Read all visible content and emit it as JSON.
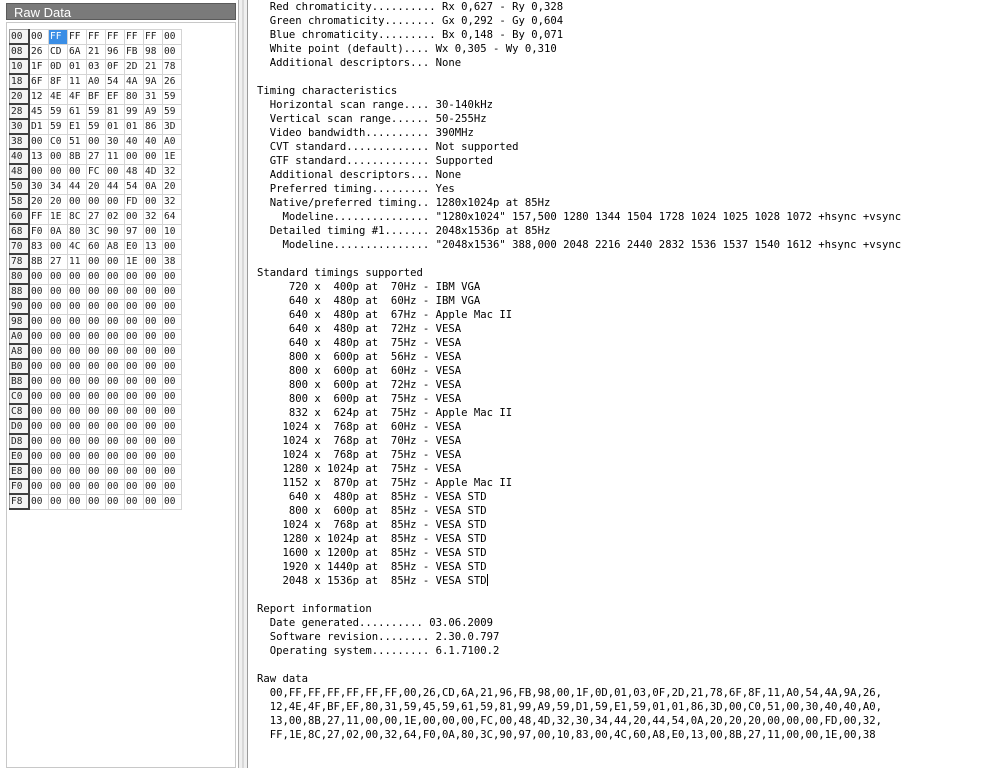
{
  "raw_panel": {
    "title": "Raw Data",
    "selected": {
      "row": 0,
      "col": 1
    },
    "rows": [
      {
        "addr": "00",
        "bytes": [
          "00",
          "FF",
          "FF",
          "FF",
          "FF",
          "FF",
          "FF",
          "00"
        ]
      },
      {
        "addr": "08",
        "bytes": [
          "26",
          "CD",
          "6A",
          "21",
          "96",
          "FB",
          "98",
          "00"
        ]
      },
      {
        "addr": "10",
        "bytes": [
          "1F",
          "0D",
          "01",
          "03",
          "0F",
          "2D",
          "21",
          "78"
        ]
      },
      {
        "addr": "18",
        "bytes": [
          "6F",
          "8F",
          "11",
          "A0",
          "54",
          "4A",
          "9A",
          "26"
        ]
      },
      {
        "addr": "20",
        "bytes": [
          "12",
          "4E",
          "4F",
          "BF",
          "EF",
          "80",
          "31",
          "59"
        ]
      },
      {
        "addr": "28",
        "bytes": [
          "45",
          "59",
          "61",
          "59",
          "81",
          "99",
          "A9",
          "59"
        ]
      },
      {
        "addr": "30",
        "bytes": [
          "D1",
          "59",
          "E1",
          "59",
          "01",
          "01",
          "86",
          "3D"
        ]
      },
      {
        "addr": "38",
        "bytes": [
          "00",
          "C0",
          "51",
          "00",
          "30",
          "40",
          "40",
          "A0"
        ]
      },
      {
        "addr": "40",
        "bytes": [
          "13",
          "00",
          "8B",
          "27",
          "11",
          "00",
          "00",
          "1E"
        ]
      },
      {
        "addr": "48",
        "bytes": [
          "00",
          "00",
          "00",
          "FC",
          "00",
          "48",
          "4D",
          "32"
        ]
      },
      {
        "addr": "50",
        "bytes": [
          "30",
          "34",
          "44",
          "20",
          "44",
          "54",
          "0A",
          "20"
        ]
      },
      {
        "addr": "58",
        "bytes": [
          "20",
          "20",
          "00",
          "00",
          "00",
          "FD",
          "00",
          "32"
        ]
      },
      {
        "addr": "60",
        "bytes": [
          "FF",
          "1E",
          "8C",
          "27",
          "02",
          "00",
          "32",
          "64"
        ]
      },
      {
        "addr": "68",
        "bytes": [
          "F0",
          "0A",
          "80",
          "3C",
          "90",
          "97",
          "00",
          "10"
        ]
      },
      {
        "addr": "70",
        "bytes": [
          "83",
          "00",
          "4C",
          "60",
          "A8",
          "E0",
          "13",
          "00"
        ]
      },
      {
        "addr": "78",
        "bytes": [
          "8B",
          "27",
          "11",
          "00",
          "00",
          "1E",
          "00",
          "38"
        ]
      },
      {
        "addr": "80",
        "bytes": [
          "00",
          "00",
          "00",
          "00",
          "00",
          "00",
          "00",
          "00"
        ]
      },
      {
        "addr": "88",
        "bytes": [
          "00",
          "00",
          "00",
          "00",
          "00",
          "00",
          "00",
          "00"
        ]
      },
      {
        "addr": "90",
        "bytes": [
          "00",
          "00",
          "00",
          "00",
          "00",
          "00",
          "00",
          "00"
        ]
      },
      {
        "addr": "98",
        "bytes": [
          "00",
          "00",
          "00",
          "00",
          "00",
          "00",
          "00",
          "00"
        ]
      },
      {
        "addr": "A0",
        "bytes": [
          "00",
          "00",
          "00",
          "00",
          "00",
          "00",
          "00",
          "00"
        ]
      },
      {
        "addr": "A8",
        "bytes": [
          "00",
          "00",
          "00",
          "00",
          "00",
          "00",
          "00",
          "00"
        ]
      },
      {
        "addr": "B0",
        "bytes": [
          "00",
          "00",
          "00",
          "00",
          "00",
          "00",
          "00",
          "00"
        ]
      },
      {
        "addr": "B8",
        "bytes": [
          "00",
          "00",
          "00",
          "00",
          "00",
          "00",
          "00",
          "00"
        ]
      },
      {
        "addr": "C0",
        "bytes": [
          "00",
          "00",
          "00",
          "00",
          "00",
          "00",
          "00",
          "00"
        ]
      },
      {
        "addr": "C8",
        "bytes": [
          "00",
          "00",
          "00",
          "00",
          "00",
          "00",
          "00",
          "00"
        ]
      },
      {
        "addr": "D0",
        "bytes": [
          "00",
          "00",
          "00",
          "00",
          "00",
          "00",
          "00",
          "00"
        ]
      },
      {
        "addr": "D8",
        "bytes": [
          "00",
          "00",
          "00",
          "00",
          "00",
          "00",
          "00",
          "00"
        ]
      },
      {
        "addr": "E0",
        "bytes": [
          "00",
          "00",
          "00",
          "00",
          "00",
          "00",
          "00",
          "00"
        ]
      },
      {
        "addr": "E8",
        "bytes": [
          "00",
          "00",
          "00",
          "00",
          "00",
          "00",
          "00",
          "00"
        ]
      },
      {
        "addr": "F0",
        "bytes": [
          "00",
          "00",
          "00",
          "00",
          "00",
          "00",
          "00",
          "00"
        ]
      },
      {
        "addr": "F8",
        "bytes": [
          "00",
          "00",
          "00",
          "00",
          "00",
          "00",
          "00",
          "00"
        ]
      }
    ]
  },
  "report": {
    "caret_line": 42,
    "lines": [
      "  Red chromaticity.......... Rx 0,627 - Ry 0,328",
      "  Green chromaticity........ Gx 0,292 - Gy 0,604",
      "  Blue chromaticity......... Bx 0,148 - By 0,071",
      "  White point (default).... Wx 0,305 - Wy 0,310",
      "  Additional descriptors... None",
      "",
      "Timing characteristics",
      "  Horizontal scan range.... 30-140kHz",
      "  Vertical scan range...... 50-255Hz",
      "  Video bandwidth.......... 390MHz",
      "  CVT standard............. Not supported",
      "  GTF standard............. Supported",
      "  Additional descriptors... None",
      "  Preferred timing......... Yes",
      "  Native/preferred timing.. 1280x1024p at 85Hz",
      "    Modeline............... \"1280x1024\" 157,500 1280 1344 1504 1728 1024 1025 1028 1072 +hsync +vsync",
      "  Detailed timing #1....... 2048x1536p at 85Hz",
      "    Modeline............... \"2048x1536\" 388,000 2048 2216 2440 2832 1536 1537 1540 1612 +hsync +vsync",
      "",
      "Standard timings supported",
      "     720 x  400p at  70Hz - IBM VGA",
      "     640 x  480p at  60Hz - IBM VGA",
      "     640 x  480p at  67Hz - Apple Mac II",
      "     640 x  480p at  72Hz - VESA",
      "     640 x  480p at  75Hz - VESA",
      "     800 x  600p at  56Hz - VESA",
      "     800 x  600p at  60Hz - VESA",
      "     800 x  600p at  72Hz - VESA",
      "     800 x  600p at  75Hz - VESA",
      "     832 x  624p at  75Hz - Apple Mac II",
      "    1024 x  768p at  60Hz - VESA",
      "    1024 x  768p at  70Hz - VESA",
      "    1024 x  768p at  75Hz - VESA",
      "    1280 x 1024p at  75Hz - VESA",
      "    1152 x  870p at  75Hz - Apple Mac II",
      "     640 x  480p at  85Hz - VESA STD",
      "     800 x  600p at  85Hz - VESA STD",
      "    1024 x  768p at  85Hz - VESA STD",
      "    1280 x 1024p at  85Hz - VESA STD",
      "    1600 x 1200p at  85Hz - VESA STD",
      "    1920 x 1440p at  85Hz - VESA STD",
      "    2048 x 1536p at  85Hz - VESA STD",
      "",
      "Report information",
      "  Date generated.......... 03.06.2009",
      "  Software revision........ 2.30.0.797",
      "  Operating system......... 6.1.7100.2",
      "",
      "Raw data",
      "  00,FF,FF,FF,FF,FF,FF,00,26,CD,6A,21,96,FB,98,00,1F,0D,01,03,0F,2D,21,78,6F,8F,11,A0,54,4A,9A,26,",
      "  12,4E,4F,BF,EF,80,31,59,45,59,61,59,81,99,A9,59,D1,59,E1,59,01,01,86,3D,00,C0,51,00,30,40,40,A0,",
      "  13,00,8B,27,11,00,00,1E,00,00,00,FC,00,48,4D,32,30,34,44,20,44,54,0A,20,20,20,00,00,00,FD,00,32,",
      "  FF,1E,8C,27,02,00,32,64,F0,0A,80,3C,90,97,00,10,83,00,4C,60,A8,E0,13,00,8B,27,11,00,00,1E,00,38"
    ]
  }
}
